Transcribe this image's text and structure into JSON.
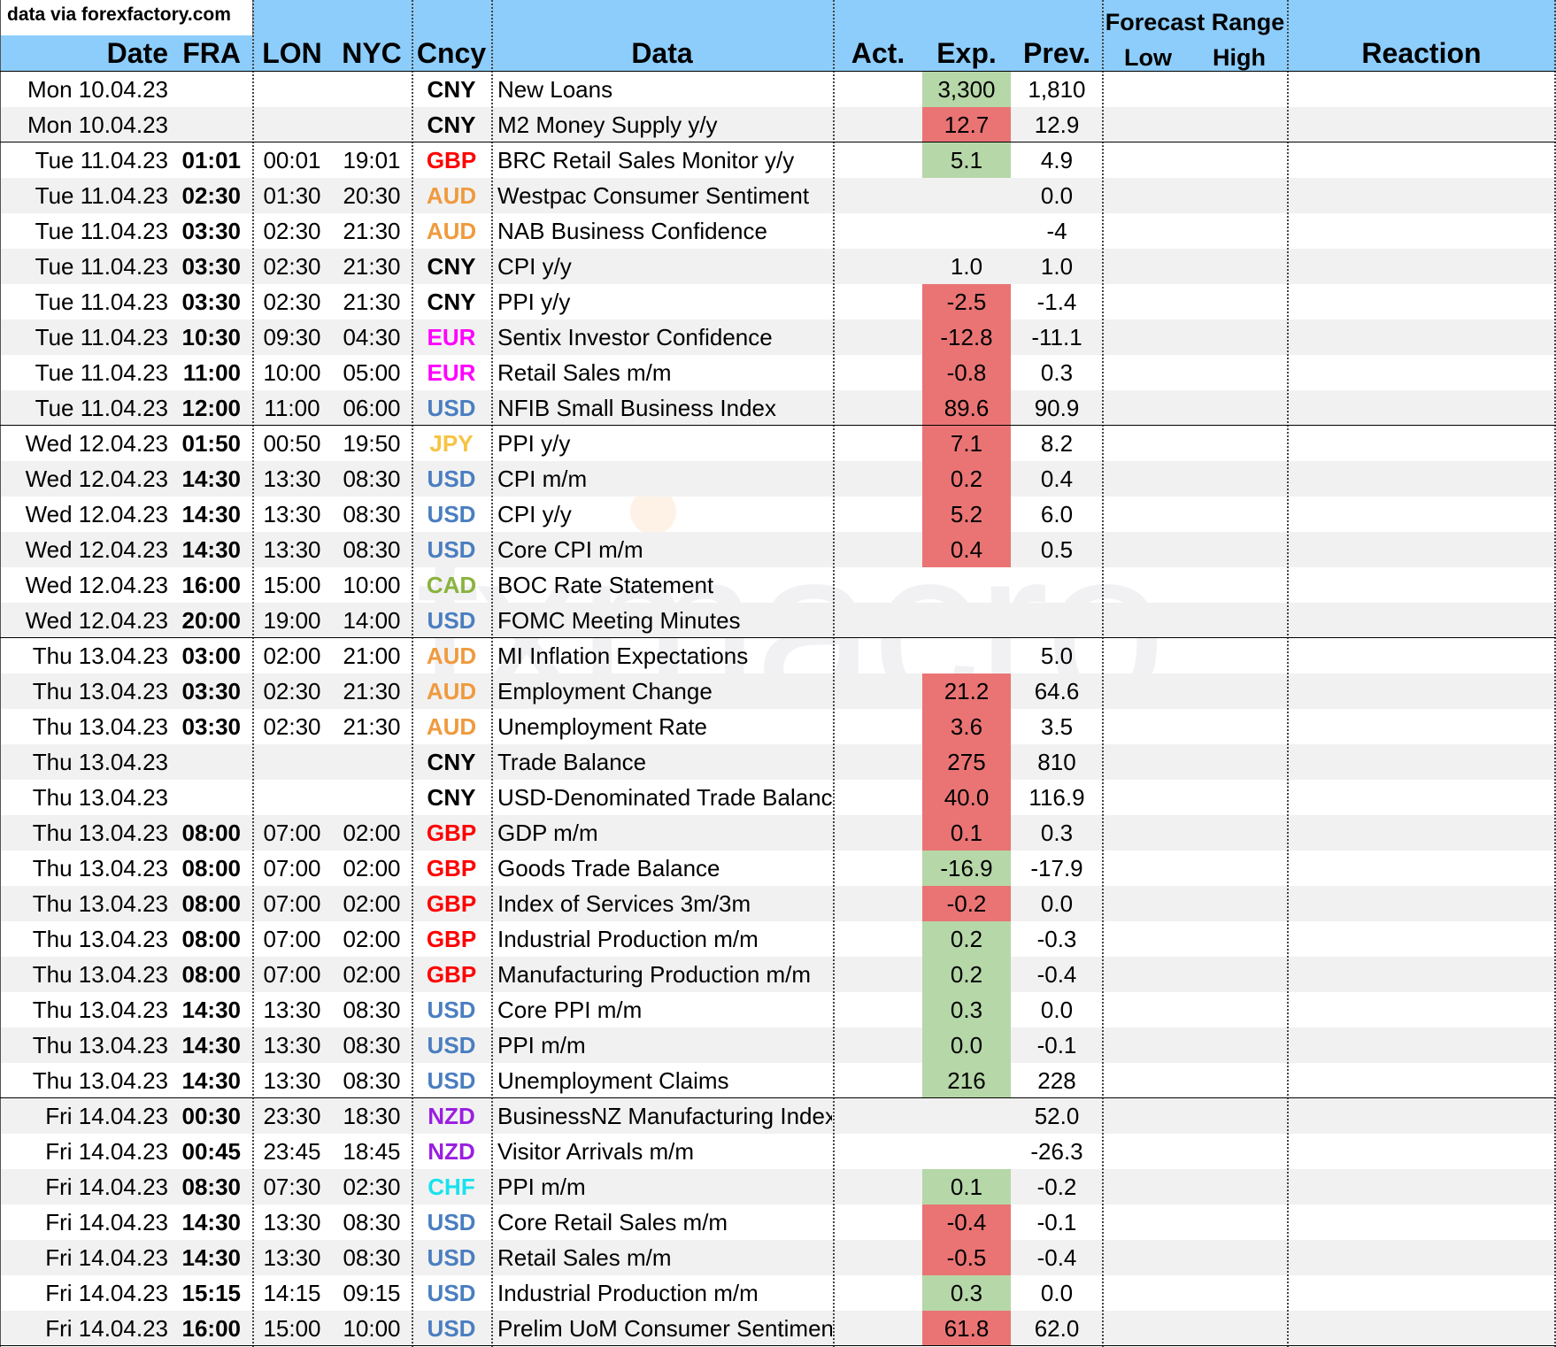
{
  "source_note": "data via forexfactory.com",
  "header": {
    "date": "Date",
    "fra": "FRA",
    "lon": "LON",
    "nyc": "NYC",
    "cncy": "Cncy",
    "data": "Data",
    "act": "Act.",
    "exp": "Exp.",
    "prev": "Prev.",
    "forecast_range": "Forecast Range",
    "low": "Low",
    "high": "High",
    "reaction": "Reaction"
  },
  "watermark": "fxmacro",
  "colors": {
    "header_bg": "#8dcdfc",
    "exp_beat": "#b6d7a8",
    "exp_miss": "#ea7474",
    "GBP": "#ff0000",
    "AUD": "#f09a3e",
    "CNY": "#000000",
    "EUR": "#ff00ff",
    "USD": "#4a7ec0",
    "JPY": "#f6c343",
    "CAD": "#8ab33d",
    "NZD": "#9a1ee0",
    "CHF": "#18e2ee"
  },
  "rows": [
    {
      "date": "Mon 10.04.23",
      "fra": "",
      "lon": "",
      "nyc": "",
      "cur": "CNY",
      "data": "New Loans",
      "act": "",
      "exp": "3,300",
      "prev": "1,810",
      "exp_color": "green"
    },
    {
      "date": "Mon 10.04.23",
      "fra": "",
      "lon": "",
      "nyc": "",
      "cur": "CNY",
      "data": "M2 Money Supply y/y",
      "act": "",
      "exp": "12.7",
      "prev": "12.9",
      "exp_color": "red"
    },
    {
      "date": "Tue 11.04.23",
      "fra": "01:01",
      "lon": "00:01",
      "nyc": "19:01",
      "cur": "GBP",
      "data": "BRC Retail Sales Monitor y/y",
      "act": "",
      "exp": "5.1",
      "prev": "4.9",
      "exp_color": "green"
    },
    {
      "date": "Tue 11.04.23",
      "fra": "02:30",
      "lon": "01:30",
      "nyc": "20:30",
      "cur": "AUD",
      "data": "Westpac Consumer Sentiment",
      "act": "",
      "exp": "",
      "prev": "0.0",
      "exp_color": ""
    },
    {
      "date": "Tue 11.04.23",
      "fra": "03:30",
      "lon": "02:30",
      "nyc": "21:30",
      "cur": "AUD",
      "data": "NAB Business Confidence",
      "act": "",
      "exp": "",
      "prev": "-4",
      "exp_color": ""
    },
    {
      "date": "Tue 11.04.23",
      "fra": "03:30",
      "lon": "02:30",
      "nyc": "21:30",
      "cur": "CNY",
      "data": "CPI y/y",
      "act": "",
      "exp": "1.0",
      "prev": "1.0",
      "exp_color": ""
    },
    {
      "date": "Tue 11.04.23",
      "fra": "03:30",
      "lon": "02:30",
      "nyc": "21:30",
      "cur": "CNY",
      "data": "PPI y/y",
      "act": "",
      "exp": "-2.5",
      "prev": "-1.4",
      "exp_color": "red"
    },
    {
      "date": "Tue 11.04.23",
      "fra": "10:30",
      "lon": "09:30",
      "nyc": "04:30",
      "cur": "EUR",
      "data": "Sentix Investor Confidence",
      "act": "",
      "exp": "-12.8",
      "prev": "-11.1",
      "exp_color": "red"
    },
    {
      "date": "Tue 11.04.23",
      "fra": "11:00",
      "lon": "10:00",
      "nyc": "05:00",
      "cur": "EUR",
      "data": "Retail Sales m/m",
      "act": "",
      "exp": "-0.8",
      "prev": "0.3",
      "exp_color": "red"
    },
    {
      "date": "Tue 11.04.23",
      "fra": "12:00",
      "lon": "11:00",
      "nyc": "06:00",
      "cur": "USD",
      "data": "NFIB Small Business Index",
      "act": "",
      "exp": "89.6",
      "prev": "90.9",
      "exp_color": "red"
    },
    {
      "date": "Wed 12.04.23",
      "fra": "01:50",
      "lon": "00:50",
      "nyc": "19:50",
      "cur": "JPY",
      "data": "PPI y/y",
      "act": "",
      "exp": "7.1",
      "prev": "8.2",
      "exp_color": "red"
    },
    {
      "date": "Wed 12.04.23",
      "fra": "14:30",
      "lon": "13:30",
      "nyc": "08:30",
      "cur": "USD",
      "data": "CPI m/m",
      "act": "",
      "exp": "0.2",
      "prev": "0.4",
      "exp_color": "red"
    },
    {
      "date": "Wed 12.04.23",
      "fra": "14:30",
      "lon": "13:30",
      "nyc": "08:30",
      "cur": "USD",
      "data": "CPI y/y",
      "act": "",
      "exp": "5.2",
      "prev": "6.0",
      "exp_color": "red"
    },
    {
      "date": "Wed 12.04.23",
      "fra": "14:30",
      "lon": "13:30",
      "nyc": "08:30",
      "cur": "USD",
      "data": "Core CPI m/m",
      "act": "",
      "exp": "0.4",
      "prev": "0.5",
      "exp_color": "red"
    },
    {
      "date": "Wed 12.04.23",
      "fra": "16:00",
      "lon": "15:00",
      "nyc": "10:00",
      "cur": "CAD",
      "data": "BOC Rate Statement",
      "act": "",
      "exp": "",
      "prev": "",
      "exp_color": ""
    },
    {
      "date": "Wed 12.04.23",
      "fra": "20:00",
      "lon": "19:00",
      "nyc": "14:00",
      "cur": "USD",
      "data": "FOMC Meeting Minutes",
      "act": "",
      "exp": "",
      "prev": "",
      "exp_color": ""
    },
    {
      "date": "Thu 13.04.23",
      "fra": "03:00",
      "lon": "02:00",
      "nyc": "21:00",
      "cur": "AUD",
      "data": "MI Inflation Expectations",
      "act": "",
      "exp": "",
      "prev": "5.0",
      "exp_color": ""
    },
    {
      "date": "Thu 13.04.23",
      "fra": "03:30",
      "lon": "02:30",
      "nyc": "21:30",
      "cur": "AUD",
      "data": "Employment Change",
      "act": "",
      "exp": "21.2",
      "prev": "64.6",
      "exp_color": "red"
    },
    {
      "date": "Thu 13.04.23",
      "fra": "03:30",
      "lon": "02:30",
      "nyc": "21:30",
      "cur": "AUD",
      "data": "Unemployment Rate",
      "act": "",
      "exp": "3.6",
      "prev": "3.5",
      "exp_color": "red"
    },
    {
      "date": "Thu 13.04.23",
      "fra": "",
      "lon": "",
      "nyc": "",
      "cur": "CNY",
      "data": "Trade Balance",
      "act": "",
      "exp": "275",
      "prev": "810",
      "exp_color": "red"
    },
    {
      "date": "Thu 13.04.23",
      "fra": "",
      "lon": "",
      "nyc": "",
      "cur": "CNY",
      "data": "USD-Denominated Trade Balance",
      "act": "",
      "exp": "40.0",
      "prev": "116.9",
      "exp_color": "red"
    },
    {
      "date": "Thu 13.04.23",
      "fra": "08:00",
      "lon": "07:00",
      "nyc": "02:00",
      "cur": "GBP",
      "data": "GDP m/m",
      "act": "",
      "exp": "0.1",
      "prev": "0.3",
      "exp_color": "red"
    },
    {
      "date": "Thu 13.04.23",
      "fra": "08:00",
      "lon": "07:00",
      "nyc": "02:00",
      "cur": "GBP",
      "data": "Goods Trade Balance",
      "act": "",
      "exp": "-16.9",
      "prev": "-17.9",
      "exp_color": "green"
    },
    {
      "date": "Thu 13.04.23",
      "fra": "08:00",
      "lon": "07:00",
      "nyc": "02:00",
      "cur": "GBP",
      "data": "Index of Services 3m/3m",
      "act": "",
      "exp": "-0.2",
      "prev": "0.0",
      "exp_color": "red"
    },
    {
      "date": "Thu 13.04.23",
      "fra": "08:00",
      "lon": "07:00",
      "nyc": "02:00",
      "cur": "GBP",
      "data": "Industrial Production m/m",
      "act": "",
      "exp": "0.2",
      "prev": "-0.3",
      "exp_color": "green"
    },
    {
      "date": "Thu 13.04.23",
      "fra": "08:00",
      "lon": "07:00",
      "nyc": "02:00",
      "cur": "GBP",
      "data": "Manufacturing Production m/m",
      "act": "",
      "exp": "0.2",
      "prev": "-0.4",
      "exp_color": "green"
    },
    {
      "date": "Thu 13.04.23",
      "fra": "14:30",
      "lon": "13:30",
      "nyc": "08:30",
      "cur": "USD",
      "data": "Core PPI m/m",
      "act": "",
      "exp": "0.3",
      "prev": "0.0",
      "exp_color": "green"
    },
    {
      "date": "Thu 13.04.23",
      "fra": "14:30",
      "lon": "13:30",
      "nyc": "08:30",
      "cur": "USD",
      "data": "PPI m/m",
      "act": "",
      "exp": "0.0",
      "prev": "-0.1",
      "exp_color": "green"
    },
    {
      "date": "Thu 13.04.23",
      "fra": "14:30",
      "lon": "13:30",
      "nyc": "08:30",
      "cur": "USD",
      "data": "Unemployment Claims",
      "act": "",
      "exp": "216",
      "prev": "228",
      "exp_color": "green"
    },
    {
      "date": "Fri 14.04.23",
      "fra": "00:30",
      "lon": "23:30",
      "nyc": "18:30",
      "cur": "NZD",
      "data": "BusinessNZ Manufacturing Index",
      "act": "",
      "exp": "",
      "prev": "52.0",
      "exp_color": ""
    },
    {
      "date": "Fri 14.04.23",
      "fra": "00:45",
      "lon": "23:45",
      "nyc": "18:45",
      "cur": "NZD",
      "data": "Visitor Arrivals m/m",
      "act": "",
      "exp": "",
      "prev": "-26.3",
      "exp_color": ""
    },
    {
      "date": "Fri 14.04.23",
      "fra": "08:30",
      "lon": "07:30",
      "nyc": "02:30",
      "cur": "CHF",
      "data": "PPI m/m",
      "act": "",
      "exp": "0.1",
      "prev": "-0.2",
      "exp_color": "green"
    },
    {
      "date": "Fri 14.04.23",
      "fra": "14:30",
      "lon": "13:30",
      "nyc": "08:30",
      "cur": "USD",
      "data": "Core Retail Sales m/m",
      "act": "",
      "exp": "-0.4",
      "prev": "-0.1",
      "exp_color": "red"
    },
    {
      "date": "Fri 14.04.23",
      "fra": "14:30",
      "lon": "13:30",
      "nyc": "08:30",
      "cur": "USD",
      "data": "Retail Sales m/m",
      "act": "",
      "exp": "-0.5",
      "prev": "-0.4",
      "exp_color": "red"
    },
    {
      "date": "Fri 14.04.23",
      "fra": "15:15",
      "lon": "14:15",
      "nyc": "09:15",
      "cur": "USD",
      "data": "Industrial Production m/m",
      "act": "",
      "exp": "0.3",
      "prev": "0.0",
      "exp_color": "green"
    },
    {
      "date": "Fri 14.04.23",
      "fra": "16:00",
      "lon": "15:00",
      "nyc": "10:00",
      "cur": "USD",
      "data": "Prelim UoM Consumer Sentiment",
      "act": "",
      "exp": "61.8",
      "prev": "62.0",
      "exp_color": "red"
    }
  ]
}
